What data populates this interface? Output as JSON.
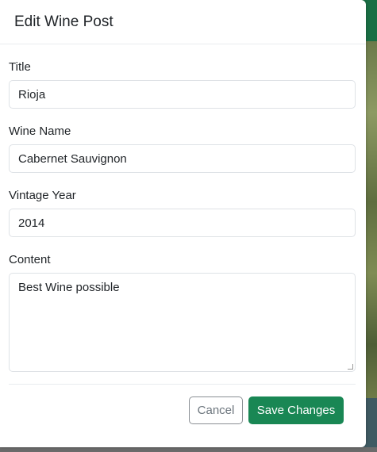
{
  "modal": {
    "title": "Edit Wine Post"
  },
  "form": {
    "title_label": "Title",
    "title_value": "Rioja",
    "wine_name_label": "Wine Name",
    "wine_name_value": "Cabernet Sauvignon",
    "vintage_label": "Vintage Year",
    "vintage_value": "2014",
    "content_label": "Content",
    "content_value": "Best Wine possible"
  },
  "footer": {
    "cancel_label": "Cancel",
    "save_label": "Save Changes"
  },
  "colors": {
    "primary_button": "#198754",
    "background_header": "#1a6e44"
  }
}
